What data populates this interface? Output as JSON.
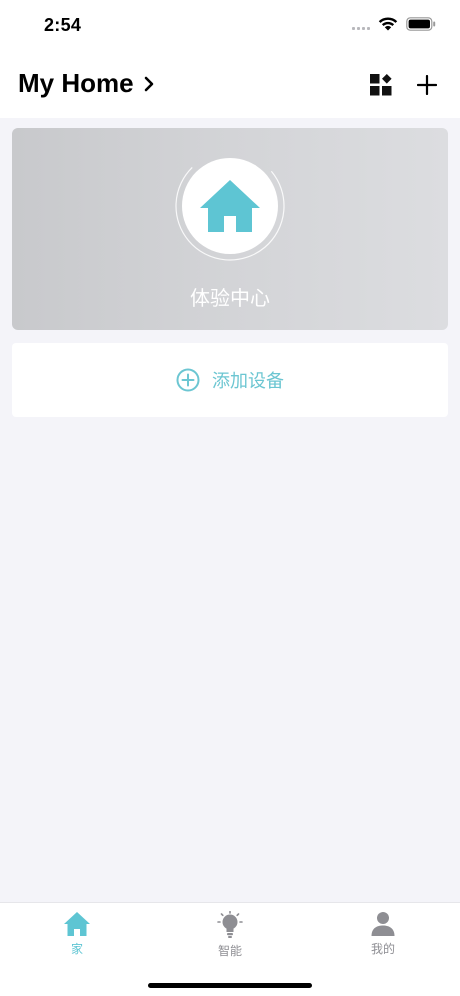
{
  "status_bar": {
    "time": "2:54"
  },
  "header": {
    "title": "My Home",
    "chevron_icon": "chevron-right-icon",
    "widgets_icon": "widgets-icon",
    "add_icon": "plus-icon"
  },
  "hero": {
    "label": "体验中心",
    "icon": "house-icon"
  },
  "add_device": {
    "label": "添加设备",
    "icon": "plus-circle-icon"
  },
  "tabs": [
    {
      "label": "家",
      "icon": "house-icon",
      "active": true
    },
    {
      "label": "智能",
      "icon": "lightbulb-icon",
      "active": false
    },
    {
      "label": "我的",
      "icon": "person-icon",
      "active": false
    }
  ],
  "colors": {
    "accent": "#5ec5d3",
    "inactive": "#8e8e93",
    "background": "#f4f4f9"
  }
}
